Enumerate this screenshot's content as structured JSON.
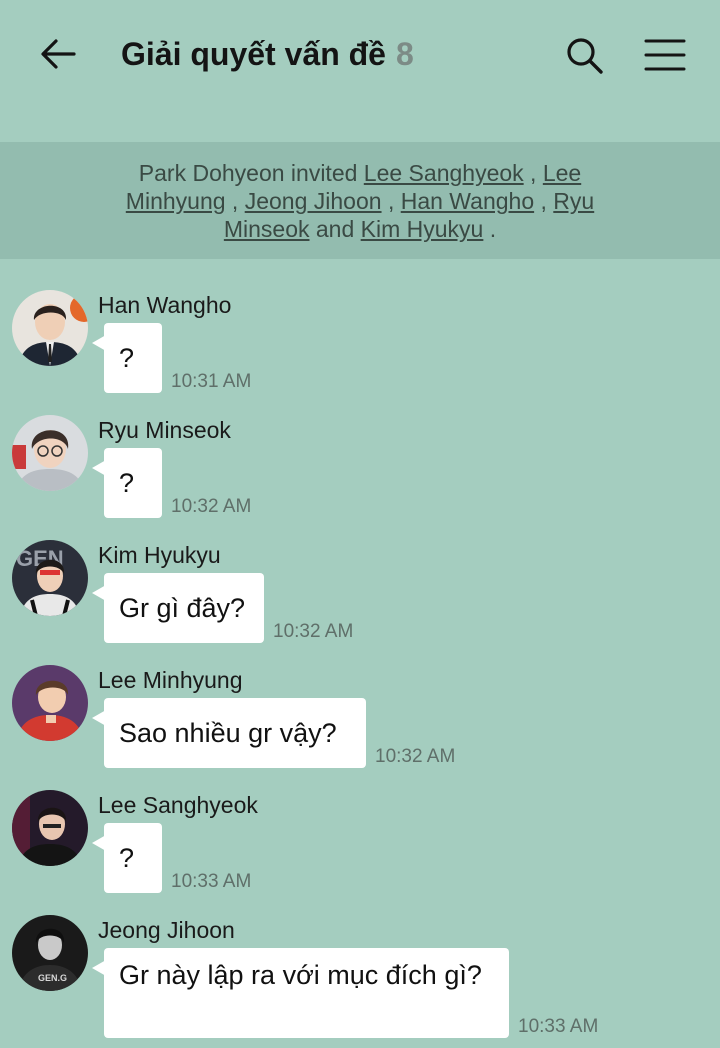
{
  "header": {
    "title": "Giải quyết vấn đề",
    "member_count": "8",
    "back_icon": "arrow-left-icon",
    "search_icon": "search-icon",
    "menu_icon": "hamburger-menu-icon"
  },
  "notice": {
    "inviter": "Park Dohyeon",
    "verb": "invited",
    "invitees": [
      "Lee Sanghyeok",
      "Lee Minhyung",
      "Jeong Jihoon",
      "Han Wangho",
      "Ryu Minseok",
      "Kim Hyukyu"
    ],
    "sep": ",",
    "and": "and",
    "end": "."
  },
  "messages": [
    {
      "sender": "Han Wangho",
      "text": "?",
      "time": "10:31 AM"
    },
    {
      "sender": "Ryu Minseok",
      "text": "?",
      "time": "10:32 AM"
    },
    {
      "sender": "Kim Hyukyu",
      "text": "Gr gì đây?",
      "time": "10:32 AM"
    },
    {
      "sender": "Lee Minhyung",
      "text": "Sao nhiều gr vậy?",
      "time": "10:32 AM"
    },
    {
      "sender": "Lee Sanghyeok",
      "text": "?",
      "time": "10:33 AM"
    },
    {
      "sender": "Jeong Jihoon",
      "text": "Gr này lập ra với mục đích gì?",
      "time": "10:33 AM"
    }
  ],
  "colors": {
    "background": "#a4cdbf",
    "notice_background": "#93bcaf",
    "bubble": "#ffffff",
    "count": "#7c8b86"
  }
}
